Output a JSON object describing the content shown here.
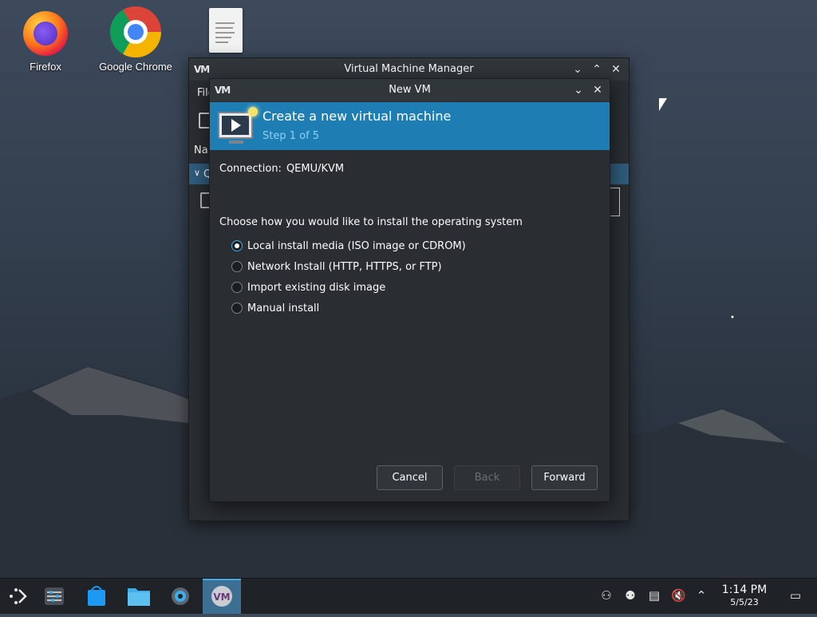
{
  "desktop": {
    "icons": [
      {
        "label": "Firefox"
      },
      {
        "label": "Google Chrome"
      },
      {
        "label": ""
      }
    ]
  },
  "back_window": {
    "title": "Virtual Machine Manager",
    "menu_partial": "File",
    "list_header_partial": "Na",
    "row_partial": "Q"
  },
  "dialog": {
    "title": "New VM",
    "banner": {
      "heading": "Create a new virtual machine",
      "step": "Step 1 of 5"
    },
    "connection_label": "Connection:",
    "connection_value": "QEMU/KVM",
    "prompt": "Choose how you would like to install the operating system",
    "options": [
      {
        "label": "Local install media (ISO image or CDROM)",
        "selected": true
      },
      {
        "label": "Network Install (HTTP, HTTPS, or FTP)",
        "selected": false
      },
      {
        "label": "Import existing disk image",
        "selected": false
      },
      {
        "label": "Manual install",
        "selected": false
      }
    ],
    "buttons": {
      "cancel": "Cancel",
      "back": "Back",
      "forward": "Forward"
    }
  },
  "taskbar": {
    "apps": [
      "application-launcher",
      "system-settings-sliders",
      "discover-store",
      "file-manager",
      "system-settings",
      "virt-manager"
    ],
    "active_app": "virt-manager",
    "clock_time": "1:14 PM",
    "clock_date": "5/5/23"
  },
  "colors": {
    "banner": "#1e7eb4",
    "accent": "#3daee9",
    "window_bg": "#2a2e32",
    "taskbar_bg": "#1f2226"
  }
}
